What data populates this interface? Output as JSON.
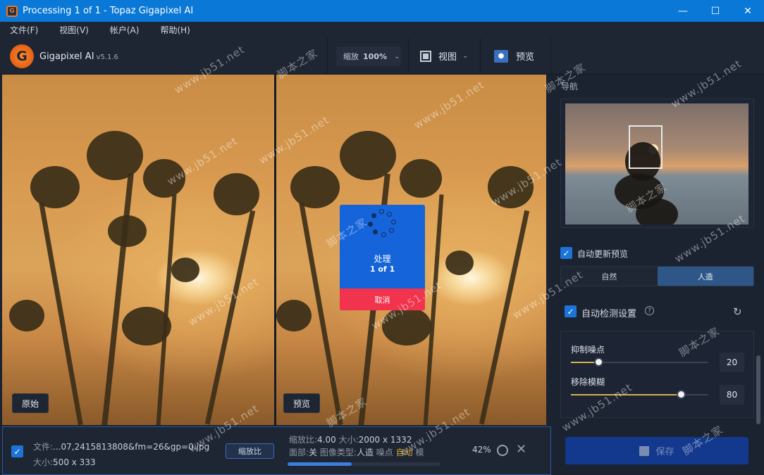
{
  "window": {
    "title": "Processing 1 of 1 - Topaz Gigapixel AI",
    "app_icon_letter": "G",
    "minimize": "—",
    "maximize": "☐",
    "close": "✕"
  },
  "menu": [
    {
      "label": "文件(F)"
    },
    {
      "label": "视图(V)"
    },
    {
      "label": "帐户(A)"
    },
    {
      "label": "帮助(H)"
    }
  ],
  "toolbar": {
    "logo_letter": "G",
    "brand": "Gigapixel AI",
    "version": "v5.1.6",
    "zoom_label": "缩放",
    "zoom_value": "100%",
    "view_label": "视图",
    "preview_label": "预览"
  },
  "panels": {
    "original_label": "原始",
    "preview_label": "预览"
  },
  "processing": {
    "label": "处理",
    "count": "1 of 1",
    "cancel": "取消"
  },
  "sidebar": {
    "nav_label": "导航",
    "auto_update_label": "自动更新预览",
    "auto_update_checked": true,
    "modes": [
      {
        "label": "自然",
        "active": false
      },
      {
        "label": "人造",
        "active": true
      }
    ],
    "auto_detect_label": "自动检测设置",
    "auto_detect_checked": true,
    "sliders": [
      {
        "label": "抑制噪点",
        "value": "20",
        "level": 0.2
      },
      {
        "label": "移除模糊",
        "value": "80",
        "level": 0.8
      }
    ],
    "save_label": "保存"
  },
  "bottom": {
    "file_label": "文件:",
    "file_name": "...07,2415813808&fm=26&gp=0.jpg",
    "size_label": "大小:",
    "size_value": "500 x 333",
    "scale_button": "缩放比",
    "ratio_label": "缩放比:",
    "ratio_value": "4.00",
    "out_size_label": "大小:",
    "out_size_value": "2000 x 1332",
    "face_label": "面部:",
    "face_value": "关",
    "image_type_label": "图像类型:",
    "image_type_value": "人造",
    "noise_label": "噪点",
    "noise_value": "自动",
    "blur_label": "模",
    "progress_percent": "42%",
    "progress": 0.42,
    "checked": true
  },
  "watermark": {
    "site": "www.jb51.net",
    "name": "脚本之家"
  },
  "colors": {
    "titlebar": "#0a78d7",
    "accent": "#1d74d8",
    "cancel": "#f1334d",
    "processing": "#1664d9",
    "slider_fill": "#d4b24c",
    "auto": "#d9a83a"
  }
}
